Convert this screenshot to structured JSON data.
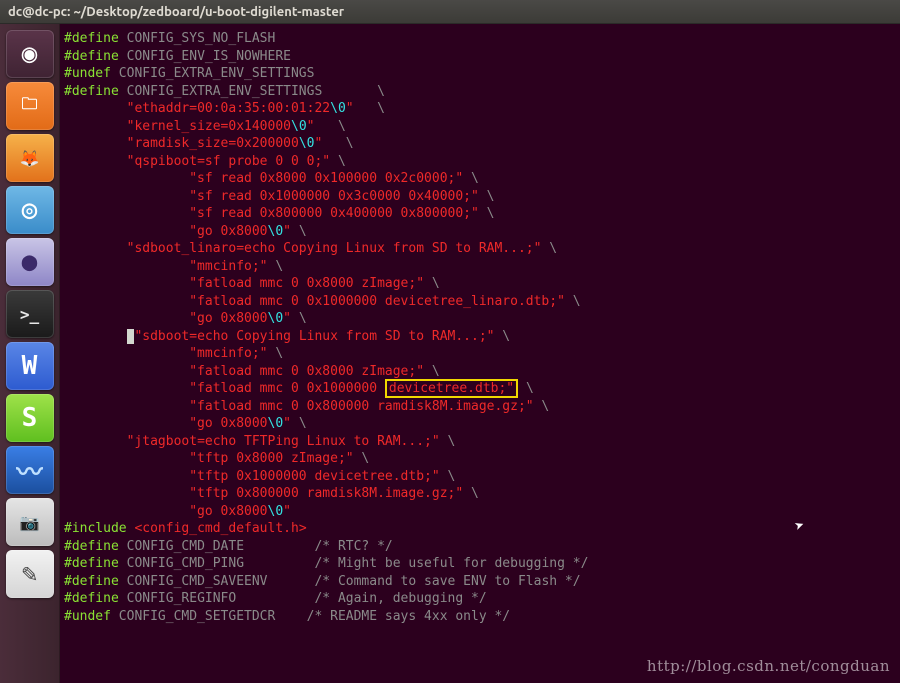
{
  "titlebar": {
    "text": "dc@dc-pc: ~/Desktop/zedboard/u-boot-digilent-master"
  },
  "launcher": [
    {
      "name": "ubuntu-dash-icon",
      "bg": "linear-gradient(#5a3449,#3f2333)",
      "glyph": "◉",
      "color": "#fff"
    },
    {
      "name": "files-icon",
      "bg": "linear-gradient(#f78b3b,#e26b17)",
      "glyph": "🗀",
      "color": "#fff"
    },
    {
      "name": "firefox-icon",
      "bg": "linear-gradient(#f6b24a,#e2711b)",
      "glyph": "🦊",
      "color": "#2a63c8"
    },
    {
      "name": "chromium-icon",
      "bg": "linear-gradient(#6fb8e6,#3a8cc9)",
      "glyph": "◎",
      "color": "#fff"
    },
    {
      "name": "eclipse-icon",
      "bg": "linear-gradient(#c9c5e6,#8e86c7)",
      "glyph": "●",
      "color": "#3b2a6a"
    },
    {
      "name": "terminal-icon",
      "bg": "linear-gradient(#3a3a3a,#1a1a1a)",
      "glyph": ">_",
      "color": "#e8e8e8"
    },
    {
      "name": "wps-writer-icon",
      "bg": "linear-gradient(#5a86e6,#2d5bd0)",
      "glyph": "W",
      "color": "#fff"
    },
    {
      "name": "wps-spreadsheet-icon",
      "bg": "linear-gradient(#9fe24a,#5fbf1f)",
      "glyph": "S",
      "color": "#fff"
    },
    {
      "name": "wireshark-icon",
      "bg": "linear-gradient(#3a7fe6,#1b4f9e)",
      "glyph": "〰",
      "color": "#bfe0ff"
    },
    {
      "name": "screenshot-icon",
      "bg": "linear-gradient(#e5e5e5,#bcbcbc)",
      "glyph": "📷",
      "color": "#555"
    },
    {
      "name": "text-editor-icon",
      "bg": "linear-gradient(#f2f2f2,#d5d5d5)",
      "glyph": "✎",
      "color": "#444"
    }
  ],
  "code": {
    "l1a": "#define",
    "l1b": " CONFIG_SYS_NO_FLASH",
    "l2a": "#define",
    "l2b": " CONFIG_ENV_IS_NOWHERE",
    "l3": "",
    "l4a": "#undef",
    "l4b": " CONFIG_EXTRA_ENV_SETTINGS",
    "l5a": "#define",
    "l5b": " CONFIG_EXTRA_ENV_SETTINGS       \\",
    "l6a": "        ",
    "l6b": "\"ethaddr=00:0a:35:00:01:22",
    "l6c": "\\0",
    "l6d": "\"",
    "l6e": "   \\",
    "l7a": "        ",
    "l7b": "\"kernel_size=0x140000",
    "l7c": "\\0",
    "l7d": "\"",
    "l7e": "   \\",
    "l8a": "        ",
    "l8b": "\"ramdisk_size=0x200000",
    "l8c": "\\0",
    "l8d": "\"",
    "l8e": "   \\",
    "l9a": "        ",
    "l9b": "\"qspiboot=sf probe 0 0 0;\"",
    "l9c": " \\",
    "l10a": "                ",
    "l10b": "\"sf read 0x8000 0x100000 0x2c0000;\"",
    "l10c": " \\",
    "l11a": "                ",
    "l11b": "\"sf read 0x1000000 0x3c0000 0x40000;\"",
    "l11c": " \\",
    "l12a": "                ",
    "l12b": "\"sf read 0x800000 0x400000 0x800000;\"",
    "l12c": " \\",
    "l13a": "                ",
    "l13b": "\"go 0x8000",
    "l13c": "\\0",
    "l13d": "\"",
    "l13e": " \\",
    "l14a": "        ",
    "l14b": "\"sdboot_linaro=echo Copying Linux from SD to RAM...;\"",
    "l14c": " \\",
    "l15a": "                ",
    "l15b": "\"mmcinfo;\"",
    "l15c": " \\",
    "l16a": "                ",
    "l16b": "\"fatload mmc 0 0x8000 zImage;\"",
    "l16c": " \\",
    "l17a": "                ",
    "l17b": "\"fatload mmc 0 0x1000000 devicetree_linaro.dtb;\"",
    "l17c": " \\",
    "l18a": "                ",
    "l18b": "\"go 0x8000",
    "l18c": "\\0",
    "l18d": "\"",
    "l18e": " \\",
    "l19a": "        ",
    "l19b": "\"sdboot=echo Copying Linux from SD to RAM...;\"",
    "l19c": " \\",
    "l20a": "                ",
    "l20b": "\"mmcinfo;\"",
    "l20c": " \\",
    "l21a": "                ",
    "l21b": "\"fatload mmc 0 0x8000 zImage;\"",
    "l21c": " \\",
    "l22a": "                ",
    "l22b": "\"fatload mmc 0 0x1000000 ",
    "l22hl": "devicetree.dtb;\"",
    "l22c": " \\",
    "l23a": "                ",
    "l23b": "\"fatload mmc 0 0x800000 ramdisk8M.image.gz;\"",
    "l23c": " \\",
    "l24a": "                ",
    "l24b": "\"go 0x8000",
    "l24c": "\\0",
    "l24d": "\"",
    "l24e": " \\",
    "l25a": "        ",
    "l25b": "\"jtagboot=echo TFTPing Linux to RAM...;\"",
    "l25c": " \\",
    "l26a": "                ",
    "l26b": "\"tftp 0x8000 zImage;\"",
    "l26c": " \\",
    "l27a": "                ",
    "l27b": "\"tftp 0x1000000 devicetree.dtb;\"",
    "l27c": " \\",
    "l28a": "                ",
    "l28b": "\"tftp 0x800000 ramdisk8M.image.gz;\"",
    "l28c": " \\",
    "l29a": "                ",
    "l29b": "\"go 0x8000",
    "l29c": "\\0",
    "l29d": "\"",
    "l30": "",
    "l31a": "#include ",
    "l31b": "<config_cmd_default.h>",
    "l32a": "#define",
    "l32b": " CONFIG_CMD_DATE         ",
    "l32c": "/* RTC? */",
    "l33a": "#define",
    "l33b": " CONFIG_CMD_PING         ",
    "l33c": "/* Might be useful for debugging */",
    "l34a": "#define",
    "l34b": " CONFIG_CMD_SAVEENV      ",
    "l34c": "/* Command to save ENV to Flash */",
    "l35a": "#define",
    "l35b": " CONFIG_REGINFO          ",
    "l35c": "/* Again, debugging */",
    "l36a": "#undef",
    "l36b": " CONFIG_CMD_SETGETDCR    ",
    "l36c": "/* README says 4xx only */"
  },
  "watermark": "http://blog.csdn.net/congduan"
}
